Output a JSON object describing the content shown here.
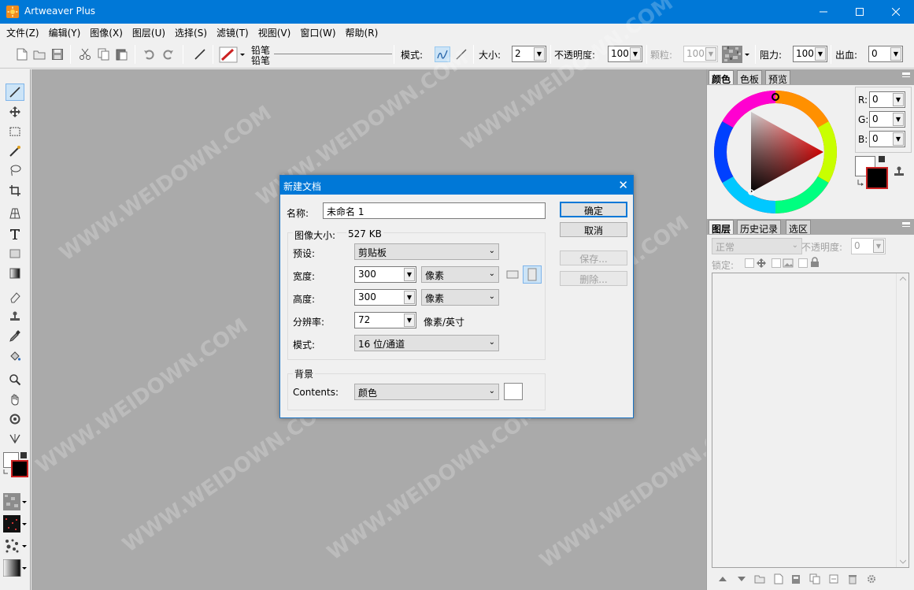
{
  "window": {
    "title": "Artweaver Plus"
  },
  "menu": [
    "文件(Z)",
    "编辑(Y)",
    "图像(X)",
    "图层(U)",
    "选择(S)",
    "滤镜(T)",
    "视图(V)",
    "窗口(W)",
    "帮助(R)"
  ],
  "toolbar": {
    "brush_name_1": "铅笔",
    "brush_name_2": "铅笔",
    "mode_label": "模式:",
    "size_label": "大小:",
    "size_value": "2",
    "opacity_label": "不透明度:",
    "opacity_value": "100",
    "grain_label": "颗粒:",
    "grain_value": "100",
    "resistance_label": "阻力:",
    "resistance_value": "100",
    "bleed_label": "出血:",
    "bleed_value": "0"
  },
  "color_panel": {
    "tabs": [
      "颜色",
      "色板",
      "预览"
    ],
    "r_label": "R:",
    "r_value": "0",
    "g_label": "G:",
    "g_value": "0",
    "b_label": "B:",
    "b_value": "0",
    "foreground": "#000000",
    "background": "#ffffff"
  },
  "layers_panel": {
    "tabs": [
      "图层",
      "历史记录",
      "选区"
    ],
    "blend_mode": "正常",
    "opacity_label": "不透明度:",
    "opacity_value": "0",
    "lock_label": "锁定:"
  },
  "dialog": {
    "title": "新建文档",
    "name_label": "名称:",
    "name_value": "未命名 1",
    "image_size_label": "图像大小:",
    "image_size_value": "527 KB",
    "preset_label": "预设:",
    "preset_value": "剪贴板",
    "width_label": "宽度:",
    "width_value": "300",
    "width_unit": "像素",
    "height_label": "高度:",
    "height_value": "300",
    "height_unit": "像素",
    "resolution_label": "分辨率:",
    "resolution_value": "72",
    "resolution_unit": "像素/英寸",
    "mode_label": "模式:",
    "mode_value": "16 位/通道",
    "background_section": "背景",
    "contents_label": "Contents:",
    "contents_value": "颜色",
    "ok_button": "确定",
    "cancel_button": "取消",
    "save_button": "保存...",
    "delete_button": "删除..."
  },
  "watermark_text": "WWW.WEIDOWN.COM"
}
